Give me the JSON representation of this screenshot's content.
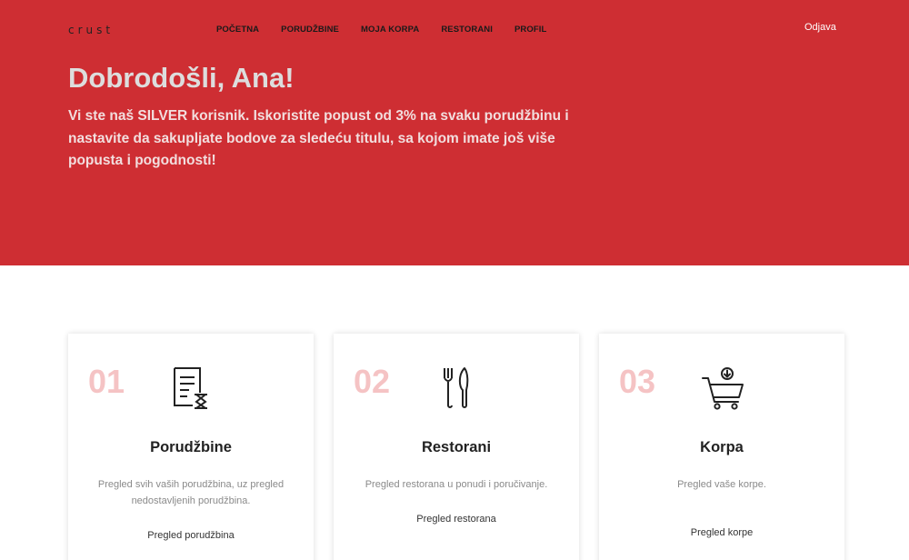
{
  "header": {
    "logo": "crust",
    "nav": [
      "POČETNA",
      "PORUDŽBINE",
      "MOJA KORPA",
      "RESTORANI",
      "PROFIL"
    ],
    "logout": "Odjava"
  },
  "hero": {
    "title": "Dobrodošli, Ana!",
    "subtitle": "Vi ste naš SILVER korisnik. Iskoristite popust od 3% na svaku porudžbinu i nastavite da sakupljate bodove za sledeću titulu, sa kojom imate još više popusta i pogodnosti!"
  },
  "cards": [
    {
      "number": "01",
      "icon": "order-list-icon",
      "title": "Porudžbine",
      "description": "Pregled svih vaših porudžbina, uz pregled nedostavljenih porudžbina.",
      "link": "Pregled porudžbina"
    },
    {
      "number": "02",
      "icon": "fork-knife-icon",
      "title": "Restorani",
      "description": "Pregled restorana u ponudi i poručivanje.",
      "link": "Pregled restorana"
    },
    {
      "number": "03",
      "icon": "shopping-cart-icon",
      "title": "Korpa",
      "description": "Pregled vaše korpe.",
      "link": "Pregled korpe"
    }
  ],
  "colors": {
    "brand": "#ce2e33",
    "number": "#f5c3c4"
  }
}
